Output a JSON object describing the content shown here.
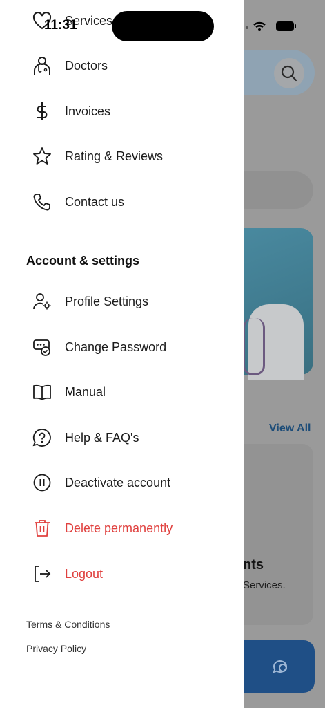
{
  "status_bar": {
    "time": "11:31"
  },
  "drawer": {
    "menu_top": [
      {
        "label": "Services",
        "icon": "heart-icon"
      },
      {
        "label": "Doctors",
        "icon": "doctor-icon"
      },
      {
        "label": "Invoices",
        "icon": "dollar-icon"
      },
      {
        "label": "Rating & Reviews",
        "icon": "star-icon"
      },
      {
        "label": "Contact us",
        "icon": "phone-icon"
      }
    ],
    "section_title": "Account & settings",
    "menu_account": [
      {
        "label": "Profile Settings",
        "icon": "user-settings-icon"
      },
      {
        "label": "Change Password",
        "icon": "password-icon"
      },
      {
        "label": "Manual",
        "icon": "book-icon"
      },
      {
        "label": "Help & FAQ's",
        "icon": "help-icon"
      },
      {
        "label": "Deactivate account",
        "icon": "pause-icon"
      },
      {
        "label": "Delete permanently",
        "icon": "trash-icon",
        "color": "#e0413f"
      },
      {
        "label": "Logout",
        "icon": "logout-icon",
        "color": "#e0413f"
      }
    ],
    "footer": {
      "terms": "Terms & Conditions",
      "privacy": "Privacy Policy"
    }
  },
  "background": {
    "view_all": "View All",
    "card_title": "nts",
    "card_subtitle": "Services."
  },
  "colors": {
    "danger": "#e0413f",
    "accent": "#1565c0"
  }
}
